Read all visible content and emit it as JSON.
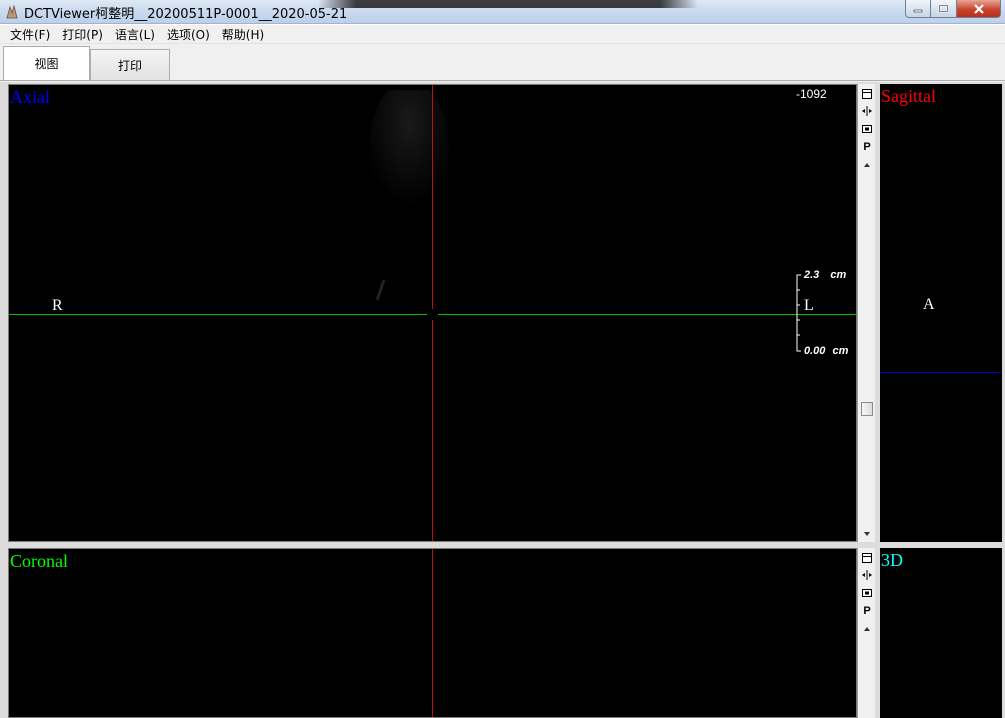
{
  "window": {
    "title": "DCTViewer柯整明__20200511P-0001__2020-05-21"
  },
  "menu": {
    "items": [
      "文件(F)",
      "打印(P)",
      "语言(L)",
      "选项(O)",
      "帮助(H)"
    ]
  },
  "tabs": [
    {
      "label": "视图",
      "active": true
    },
    {
      "label": "打印",
      "active": false
    }
  ],
  "views": {
    "axial": {
      "label": "Axial",
      "color": "#0000ff",
      "value": "-1092",
      "orientation_left": "R",
      "orientation_right": "L",
      "scale_top": "2.3",
      "scale_top_unit": "cm",
      "scale_bottom": "0.00",
      "scale_bottom_unit": "cm"
    },
    "sagittal": {
      "label": "Sagittal",
      "color": "#ff0000",
      "orientation": "A"
    },
    "coronal": {
      "label": "Coronal",
      "color": "#00ff00"
    },
    "threed": {
      "label": "3D",
      "color": "#00ffff"
    }
  },
  "toolstrip": {
    "icons": [
      "layout-icon",
      "split-icon",
      "camera-icon",
      "p-icon",
      "scroll-up-icon",
      "scroll-down-icon"
    ],
    "p_label": "P"
  },
  "crosshair": {
    "vertical_color": "#c01010",
    "horizontal_color": "#00c000",
    "sagittal_line_color": "#0000c0"
  }
}
